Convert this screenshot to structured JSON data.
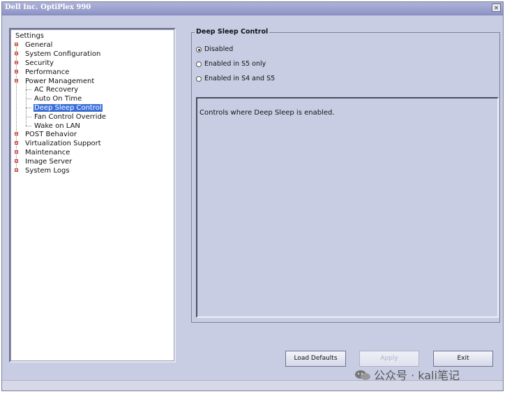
{
  "window": {
    "title": "Dell Inc. OptiPlex 990",
    "close_glyph": "×"
  },
  "tree": {
    "root": "Settings",
    "items": [
      {
        "label": "General"
      },
      {
        "label": "System Configuration"
      },
      {
        "label": "Security"
      },
      {
        "label": "Performance"
      },
      {
        "label": "Power Management"
      },
      {
        "label": "AC Recovery"
      },
      {
        "label": "Auto On Time"
      },
      {
        "label": "Deep Sleep Control"
      },
      {
        "label": "Fan Control Override"
      },
      {
        "label": "Wake on LAN"
      },
      {
        "label": "POST Behavior"
      },
      {
        "label": "Virtualization Support"
      },
      {
        "label": "Maintenance"
      },
      {
        "label": "Image Server"
      },
      {
        "label": "System Logs"
      }
    ],
    "selected": "Deep Sleep Control"
  },
  "panel": {
    "title": "Deep Sleep Control",
    "options": [
      {
        "label": "Disabled",
        "selected": true
      },
      {
        "label": "Enabled in S5 only",
        "selected": false
      },
      {
        "label": "Enabled in S4 and S5",
        "selected": false
      }
    ],
    "description": "Controls where Deep Sleep is enabled."
  },
  "buttons": {
    "load_defaults": "Load Defaults",
    "apply": "Apply",
    "exit": "Exit"
  },
  "watermark": {
    "text": "公众号 · kali笔记"
  },
  "icons": {
    "expand": "plus-box-icon",
    "collapse": "minus-box-icon",
    "radio": "radio-icon",
    "wechat": "wechat-icon"
  },
  "colors": {
    "window_bg": "#c9cde3",
    "selection": "#3a6fd8"
  }
}
